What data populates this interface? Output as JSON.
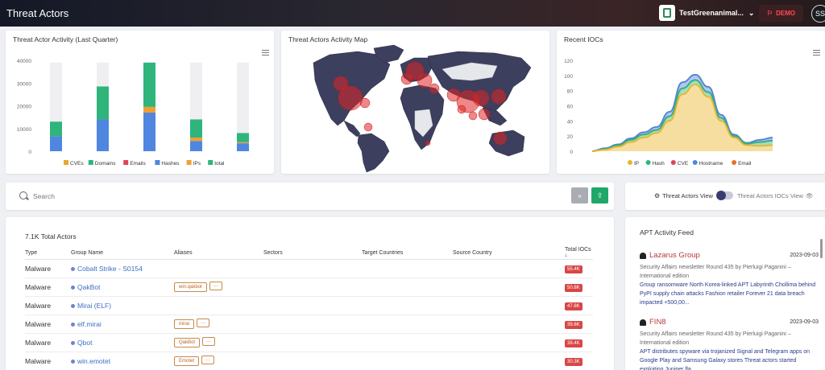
{
  "header": {
    "title": "Threat Actors",
    "org_name": "TestGreenanimal...",
    "demo_label": "DEMO",
    "user_initials": "SS"
  },
  "activity_chart": {
    "title": "Threat Actor Activity (Last Quarter)",
    "chart_data": {
      "type": "bar",
      "stacked": true,
      "categories": [
        "",
        "",
        "",
        "",
        ""
      ],
      "ylim": [
        0,
        40000
      ],
      "yticks": [
        "0",
        "10000",
        "20000",
        "30000",
        "40000"
      ],
      "series": [
        {
          "name": "CVEs",
          "color": "#e8a72e",
          "values": [
            0,
            0,
            0,
            0,
            0
          ]
        },
        {
          "name": "Domains",
          "color": "#2fb57c",
          "values": [
            0,
            0,
            0,
            0,
            0
          ]
        },
        {
          "name": "Emails",
          "color": "#e0445a",
          "values": [
            0,
            0,
            0,
            0,
            0
          ]
        },
        {
          "name": "Hashes",
          "color": "#4f86e0",
          "values": [
            6500,
            14000,
            17000,
            4500,
            3500
          ]
        },
        {
          "name": "IPs",
          "color": "#f0a033",
          "values": [
            0,
            0,
            2500,
            1500,
            500
          ]
        },
        {
          "name": "total",
          "color": "#2fb57c",
          "values": [
            6500,
            14500,
            19500,
            8000,
            4000
          ]
        }
      ],
      "background_max": [
        39000,
        39000,
        39000,
        39000,
        39000
      ]
    }
  },
  "map_card": {
    "title": "Threat Actors Activity Map"
  },
  "iocs_chart": {
    "title": "Recent IOCs",
    "chart_data": {
      "type": "area",
      "stacked": true,
      "ylim": [
        0,
        120
      ],
      "yticks": [
        "0",
        "20",
        "40",
        "60",
        "80",
        "100",
        "120"
      ],
      "x": [
        0,
        1,
        2,
        3,
        4,
        5,
        6,
        7,
        8,
        9,
        10,
        11,
        12,
        13,
        14
      ],
      "series": [
        {
          "name": "IP",
          "color": "#e8b52c",
          "values": [
            0,
            2,
            6,
            12,
            18,
            24,
            40,
            75,
            88,
            72,
            40,
            18,
            8,
            7,
            8
          ]
        },
        {
          "name": "Hash",
          "color": "#2fb57c",
          "values": [
            0,
            1,
            2,
            3,
            4,
            4,
            6,
            8,
            6,
            6,
            4,
            2,
            2,
            5,
            6
          ]
        },
        {
          "name": "CVE",
          "color": "#d9455a",
          "values": [
            0,
            0,
            0,
            0,
            0,
            0,
            0,
            0,
            0,
            0,
            0,
            0,
            0,
            0,
            0
          ]
        },
        {
          "name": "Hostname",
          "color": "#4f86e0",
          "values": [
            0,
            1,
            1,
            2,
            3,
            4,
            6,
            8,
            7,
            7,
            4,
            2,
            1,
            3,
            4
          ]
        },
        {
          "name": "Email",
          "color": "#e8702a",
          "values": [
            0,
            0,
            0,
            0,
            0,
            0,
            0,
            0,
            0,
            0,
            0,
            0,
            0,
            0,
            0
          ]
        }
      ]
    }
  },
  "search": {
    "placeholder": "Search",
    "grey_button_label": "»",
    "green_button_label": "⇪"
  },
  "view_toggle": {
    "left_label": "Threat Actors View",
    "right_label": "Threat Actors IOCs View"
  },
  "table": {
    "total_label": "7.1K Total Actors",
    "columns": [
      "Type",
      "Group Name",
      "Aliases",
      "Sectors",
      "Target Countries",
      "Source Country",
      "Total IOCs ↓"
    ],
    "rows": [
      {
        "type": "Malware",
        "name": "Cobalt Strike - S0154",
        "aliases": [],
        "more": false,
        "iocs": "55.4K"
      },
      {
        "type": "Malware",
        "name": "QakBot",
        "aliases": [
          "win.qakbot"
        ],
        "more": true,
        "iocs": "50.8K"
      },
      {
        "type": "Malware",
        "name": "Mirai (ELF)",
        "aliases": [],
        "more": false,
        "iocs": "47.8K"
      },
      {
        "type": "Malware",
        "name": "elf.mirai",
        "aliases": [
          "mirai"
        ],
        "more": true,
        "iocs": "39.6K"
      },
      {
        "type": "Malware",
        "name": "Qbot",
        "aliases": [
          "QakBot"
        ],
        "more": true,
        "iocs": "39.4K"
      },
      {
        "type": "Malware",
        "name": "win.emotet",
        "aliases": [
          "Emotet"
        ],
        "more": true,
        "iocs": "30.3K"
      }
    ]
  },
  "feed": {
    "title": "APT Activity Feed",
    "items": [
      {
        "name": "Lazarus Group",
        "date": "2023-09-03",
        "source": "Security Affairs newsletter Round 435 by Pierluigi Paganini – International edition",
        "text": "Group ransomware North Korea-linked APT Labyrinth Chollima behind PyPI supply chain attacks Fashion retailer Forever 21 data breach impacted +500,00..."
      },
      {
        "name": "FIN8",
        "date": "2023-09-03",
        "source": "Security Affairs newsletter Round 435 by Pierluigi Paganini – International edition",
        "text": "APT distributes spyware via trojanized Signal and Telegram apps on Google Play and Samsung Galaxy stores Threat actors started exploiting Juniper fla..."
      }
    ]
  }
}
